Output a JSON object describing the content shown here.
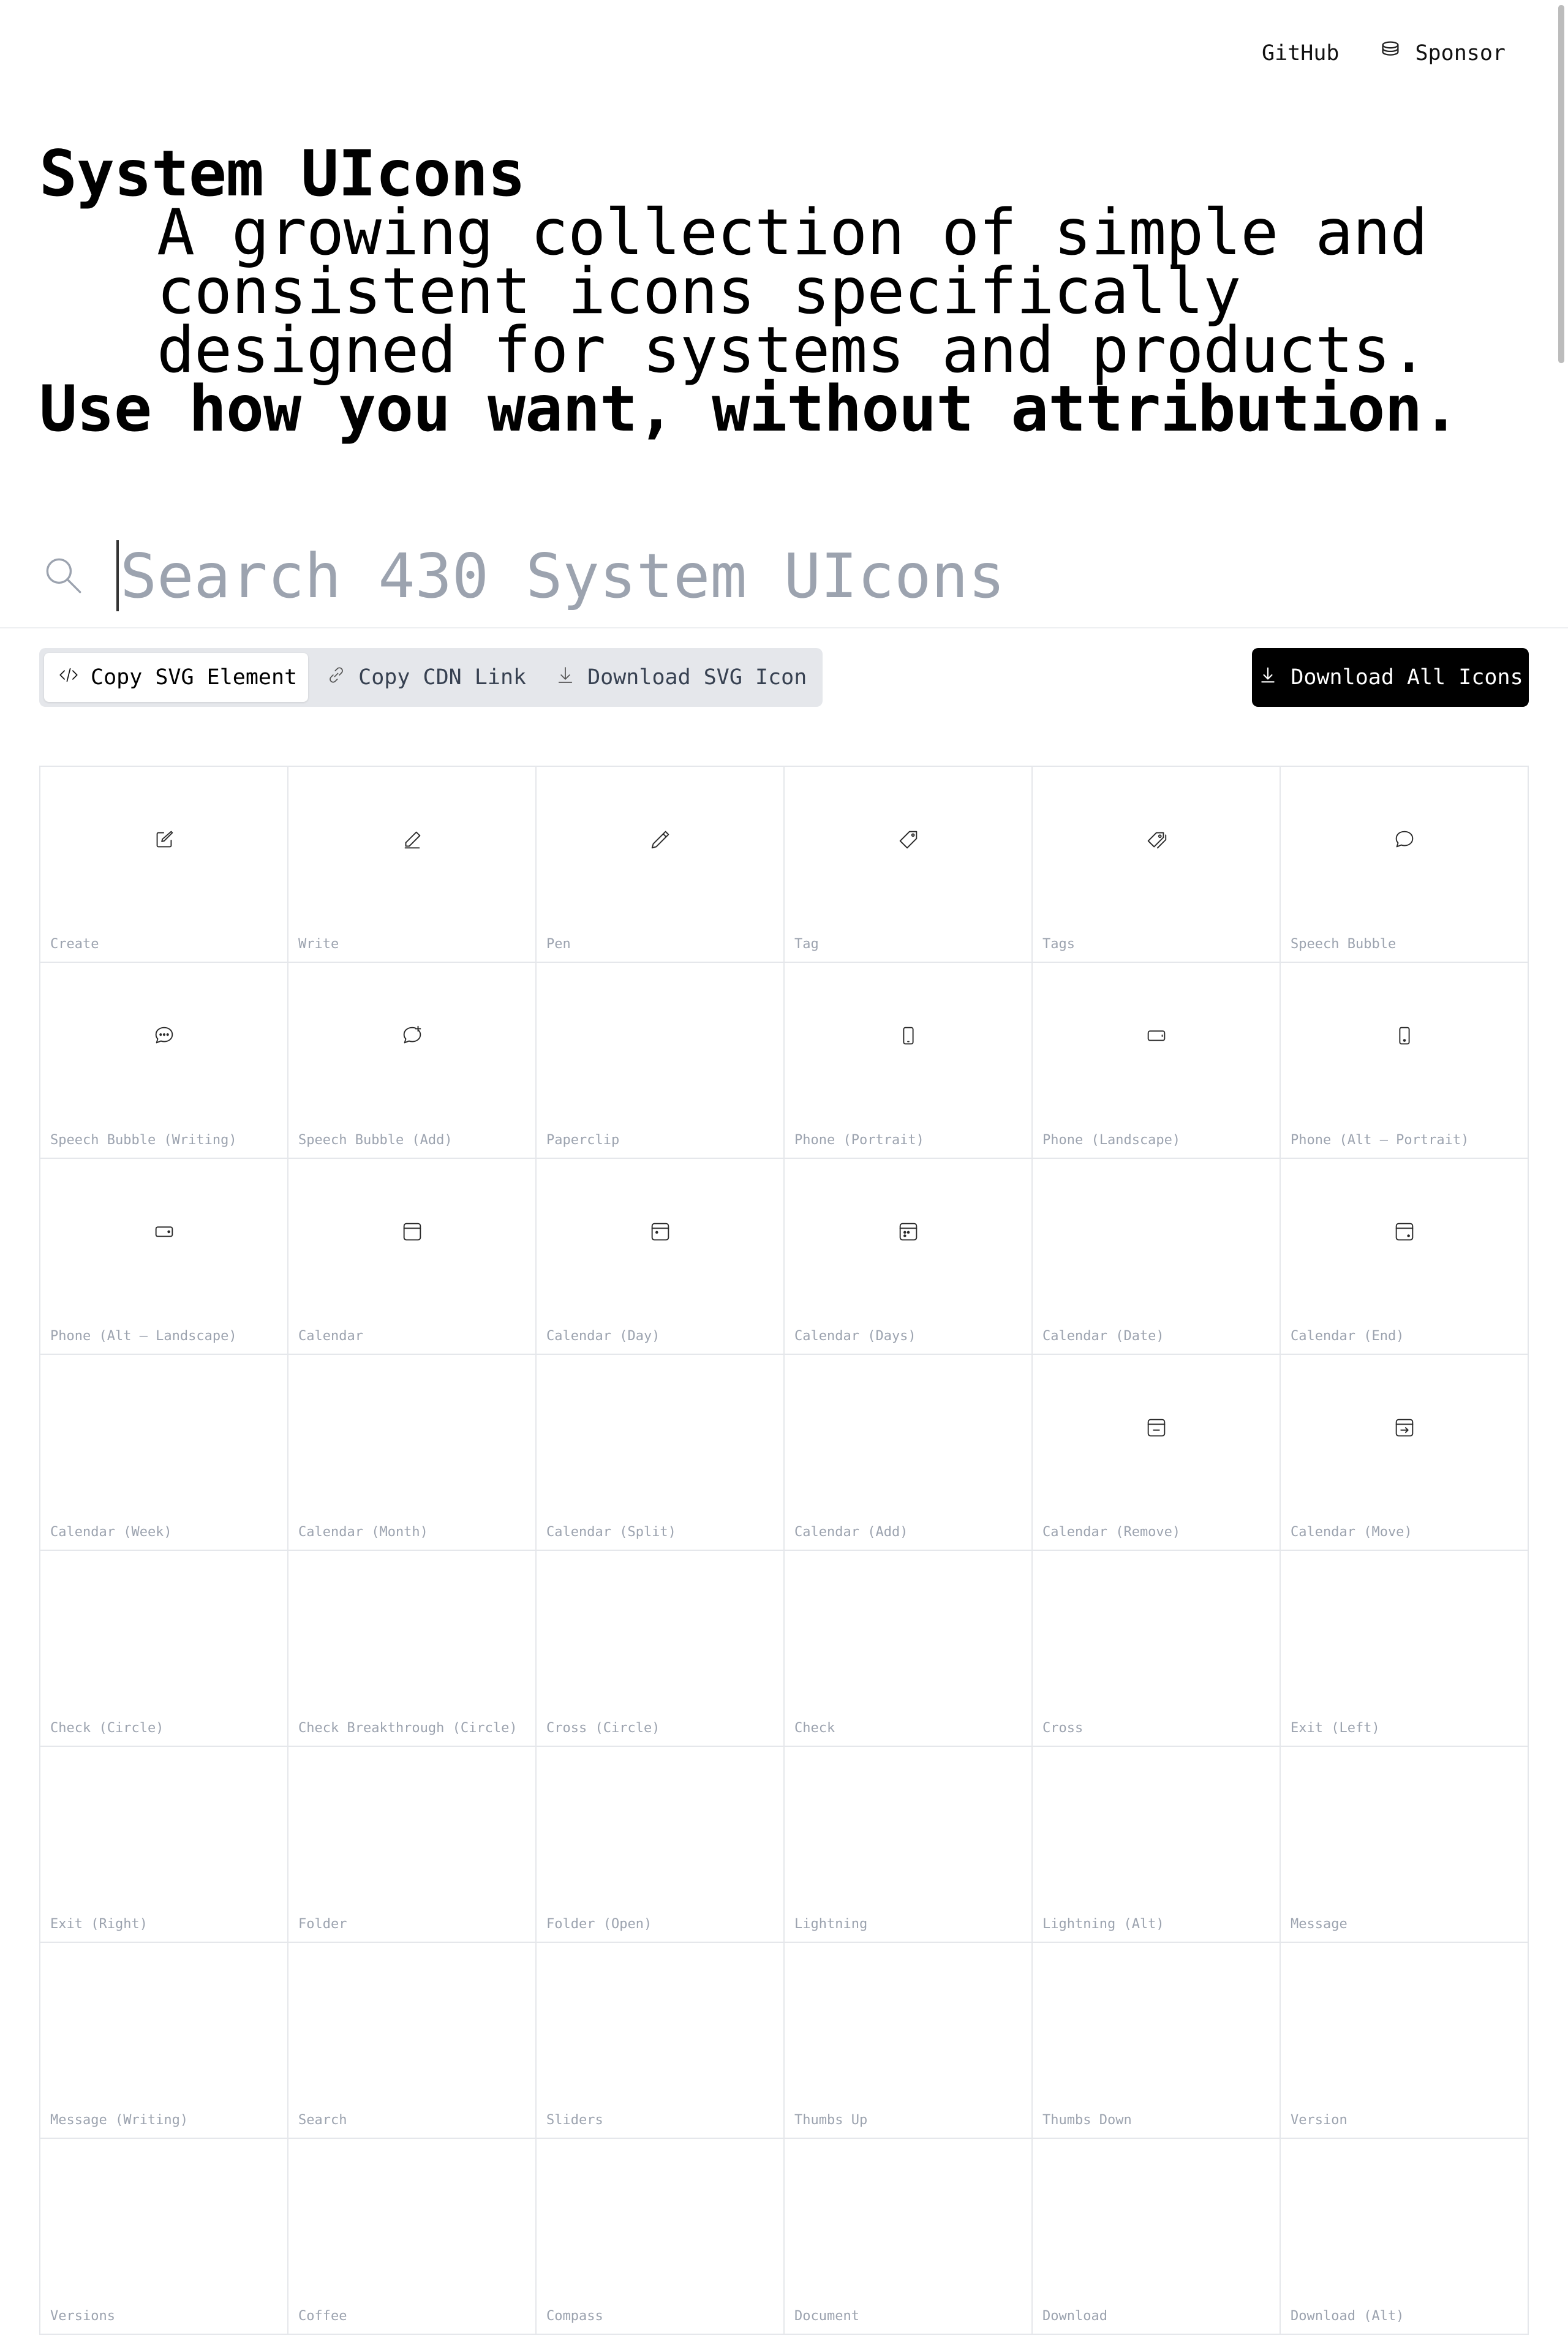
{
  "nav": {
    "github": "GitHub",
    "sponsor": "Sponsor"
  },
  "hero": {
    "title": "System UIcons",
    "tagline": "A growing collection of simple and consistent icons specifically designed for systems and products.",
    "usage": "Use how you want, without attribution."
  },
  "search": {
    "placeholder": "Search 430 System UIcons",
    "value": ""
  },
  "tabs": [
    {
      "label": "Copy SVG Element",
      "icon": "code-icon",
      "active": true
    },
    {
      "label": "Copy CDN Link",
      "icon": "link-icon",
      "active": false
    },
    {
      "label": "Download SVG Icon",
      "icon": "download-icon",
      "active": false
    }
  ],
  "download_all": {
    "label": "Download All Icons",
    "icon": "download-icon"
  },
  "icons": [
    {
      "label": "Create",
      "icon": "create"
    },
    {
      "label": "Write",
      "icon": "write"
    },
    {
      "label": "Pen",
      "icon": "pen"
    },
    {
      "label": "Tag",
      "icon": "tag"
    },
    {
      "label": "Tags",
      "icon": "tags"
    },
    {
      "label": "Speech Bubble",
      "icon": "speech-bubble"
    },
    {
      "label": "Speech Bubble (Writing)",
      "icon": "speech-bubble-writing"
    },
    {
      "label": "Speech Bubble (Add)",
      "icon": "speech-bubble-add"
    },
    {
      "label": "Paperclip",
      "icon": ""
    },
    {
      "label": "Phone (Portrait)",
      "icon": "phone-portrait"
    },
    {
      "label": "Phone (Landscape)",
      "icon": "phone-landscape"
    },
    {
      "label": "Phone (Alt – Portrait)",
      "icon": "phone-alt-portrait"
    },
    {
      "label": "Phone (Alt – Landscape)",
      "icon": "phone-alt-landscape"
    },
    {
      "label": "Calendar",
      "icon": "calendar"
    },
    {
      "label": "Calendar (Day)",
      "icon": "calendar-day"
    },
    {
      "label": "Calendar (Days)",
      "icon": "calendar-days"
    },
    {
      "label": "Calendar (Date)",
      "icon": ""
    },
    {
      "label": "Calendar (End)",
      "icon": "calendar-end"
    },
    {
      "label": "Calendar (Week)",
      "icon": ""
    },
    {
      "label": "Calendar (Month)",
      "icon": ""
    },
    {
      "label": "Calendar (Split)",
      "icon": ""
    },
    {
      "label": "Calendar (Add)",
      "icon": ""
    },
    {
      "label": "Calendar (Remove)",
      "icon": "calendar-remove"
    },
    {
      "label": "Calendar (Move)",
      "icon": "calendar-move"
    },
    {
      "label": "Check (Circle)",
      "icon": ""
    },
    {
      "label": "Check Breakthrough (Circle)",
      "icon": ""
    },
    {
      "label": "Cross (Circle)",
      "icon": ""
    },
    {
      "label": "Check",
      "icon": ""
    },
    {
      "label": "Cross",
      "icon": ""
    },
    {
      "label": "Exit (Left)",
      "icon": ""
    },
    {
      "label": "Exit (Right)",
      "icon": ""
    },
    {
      "label": "Folder",
      "icon": ""
    },
    {
      "label": "Folder (Open)",
      "icon": ""
    },
    {
      "label": "Lightning",
      "icon": ""
    },
    {
      "label": "Lightning (Alt)",
      "icon": ""
    },
    {
      "label": "Message",
      "icon": ""
    },
    {
      "label": "Message (Writing)",
      "icon": ""
    },
    {
      "label": "Search",
      "icon": ""
    },
    {
      "label": "Sliders",
      "icon": ""
    },
    {
      "label": "Thumbs Up",
      "icon": ""
    },
    {
      "label": "Thumbs Down",
      "icon": ""
    },
    {
      "label": "Version",
      "icon": ""
    },
    {
      "label": "Versions",
      "icon": ""
    },
    {
      "label": "Coffee",
      "icon": ""
    },
    {
      "label": "Compass",
      "icon": ""
    },
    {
      "label": "Document",
      "icon": ""
    },
    {
      "label": "Download",
      "icon": ""
    },
    {
      "label": "Download (Alt)",
      "icon": ""
    }
  ]
}
